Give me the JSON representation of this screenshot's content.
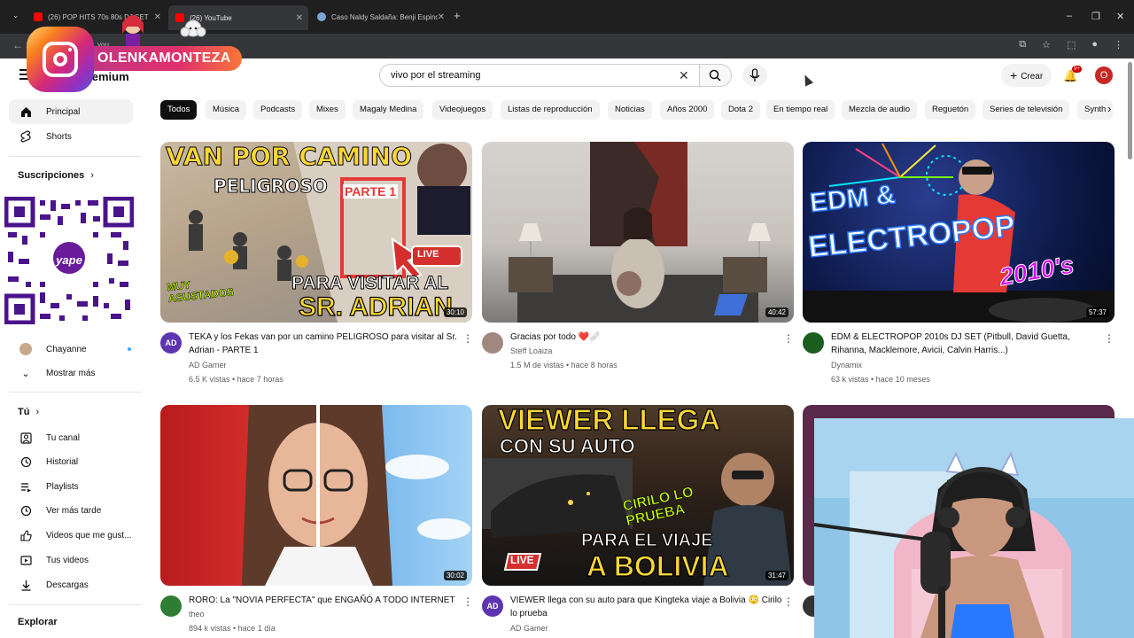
{
  "browser": {
    "tabs": [
      {
        "title": "(26) POP HITS 70s 80s DJ SET"
      },
      {
        "title": "(26) YouTube"
      },
      {
        "title": "Caso Naldy Saldaña: Benji Espinoza"
      }
    ],
    "new_tab": "+",
    "window_controls": [
      "–",
      "❐",
      "✕"
    ],
    "address_prefix": "you"
  },
  "overlay": {
    "instagram_handle": "OLENKAMONTEZA",
    "qr_label": "yape"
  },
  "header": {
    "logo_text": "Premium",
    "search_value": "vivo por el streaming",
    "create_label": "Crear",
    "notification_count": "9+",
    "avatar_letter": "O"
  },
  "sidebar": {
    "main": [
      {
        "label": "Principal",
        "icon": "home-icon"
      },
      {
        "label": "Shorts",
        "icon": "shorts-icon"
      }
    ],
    "subscriptions_title": "Suscripciones",
    "subscriptions": [
      {
        "label": "Chayanne"
      }
    ],
    "show_more": "Mostrar más",
    "you_title": "Tú",
    "you_items": [
      {
        "label": "Tu canal"
      },
      {
        "label": "Historial"
      },
      {
        "label": "Playlists"
      },
      {
        "label": "Ver más tarde"
      },
      {
        "label": "Videos que me gust..."
      },
      {
        "label": "Tus videos"
      },
      {
        "label": "Descargas"
      }
    ],
    "explore_title": "Explorar"
  },
  "chips": [
    "Todos",
    "Música",
    "Podcasts",
    "Mixes",
    "Magaly Medina",
    "Videojuegos",
    "Listas de reproducción",
    "Noticias",
    "Años 2000",
    "Dota 2",
    "En tiempo real",
    "Mezcla de audio",
    "Reguetón",
    "Series de televisión",
    "Synth"
  ],
  "videos": [
    {
      "title": "TEKA y los Fekas van por un camino PELIGROSO para visitar al Sr. Adrian - PARTE 1",
      "channel": "AD Gamer",
      "meta": "6.5 K vistas • hace 7 horas",
      "duration": "30:10",
      "thumb_text": [
        "VAN POR CAMINO",
        "PELIGROSO",
        "PARTE 1",
        "MUY ASUSTADOS",
        "PARA VISITAR AL",
        "SR. ADRIAN"
      ]
    },
    {
      "title": "Gracias por todo ❤️🩹",
      "channel": "Steff Loaiza",
      "meta": "1.5 M de vistas • hace 8 horas",
      "duration": "40:42"
    },
    {
      "title": "EDM & ELECTROPOP 2010s DJ SET (Pitbull, David Guetta, Rihanna, Macklemore, Avicii, Calvin Harris...)",
      "channel": "Dynamix",
      "meta": "63 k vistas • hace 10 meses",
      "duration": "57:37",
      "thumb_text": [
        "EDM &",
        "ELECTROPOP",
        "2010's"
      ]
    },
    {
      "title": "RORO: La \"NOVIA PERFECTA\" que ENGAÑÓ A TODO INTERNET",
      "channel": "theo",
      "meta": "894 k vistas • hace 1 día",
      "duration": "30:02"
    },
    {
      "title": "VIEWER llega con su auto para que Kingteka viaje a Bolivia 😳 Cirilo lo prueba",
      "channel": "AD Gamer",
      "meta": "",
      "duration": "31:47",
      "thumb_text": [
        "VIEWER LLEGA",
        "CON SU AUTO",
        "CIRILO LO PRUEBA",
        "PARA EL VIAJE",
        "A BOLIVIA"
      ]
    }
  ],
  "live_badge": "LIVE",
  "colors": {
    "yt_red": "#ff0000",
    "chip_active": "#0f0f0f",
    "ig_gradient_start": "#feda75",
    "ig_gradient_end": "#4f5bd5",
    "yape_purple": "#6a1b9a"
  }
}
